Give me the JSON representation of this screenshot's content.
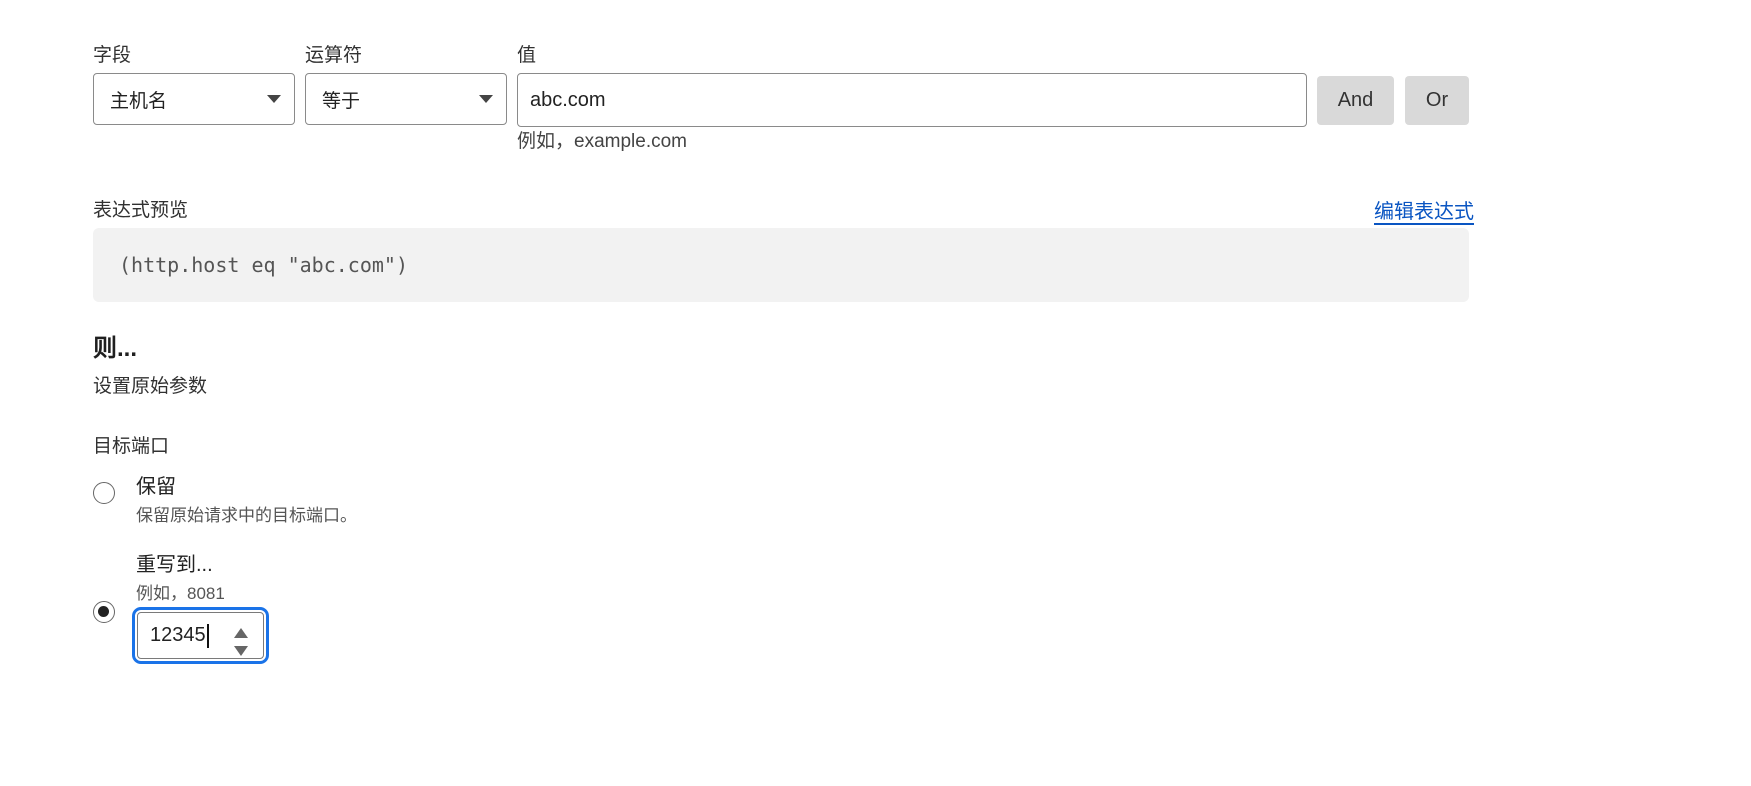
{
  "filter": {
    "field_label": "字段",
    "operator_label": "运算符",
    "value_label": "值",
    "field_selected": "主机名",
    "operator_selected": "等于",
    "value": "abc.com",
    "value_hint": "例如，example.com",
    "and_label": "And",
    "or_label": "Or"
  },
  "expression": {
    "label": "表达式预览",
    "edit_link": "编辑表达式",
    "code": "(http.host eq \"abc.com\")"
  },
  "then": {
    "heading": "则...",
    "action": "设置原始参数"
  },
  "destination_port": {
    "label": "目标端口",
    "options": [
      {
        "title": "保留",
        "desc": "保留原始请求中的目标端口。",
        "checked": false
      },
      {
        "title": "重写到...",
        "desc": "例如，8081",
        "checked": true
      }
    ],
    "port_value": "12345"
  },
  "colors": {
    "link": "#0a55c2",
    "focus": "#1a73e8",
    "button_bg": "#d9d9d9",
    "code_bg": "#f2f2f2"
  }
}
